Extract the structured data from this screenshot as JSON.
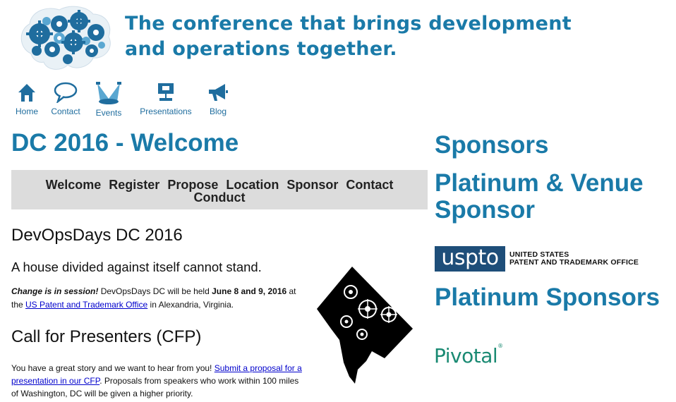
{
  "header": {
    "tagline_line1": "The conference that brings development",
    "tagline_line2": "and operations together."
  },
  "topnav": [
    {
      "label": "Home",
      "icon": "house-icon"
    },
    {
      "label": "Contact",
      "icon": "speech-bubble-icon"
    },
    {
      "label": "Events",
      "icon": "spotlight-icon"
    },
    {
      "label": "Presentations",
      "icon": "projector-icon"
    },
    {
      "label": "Blog",
      "icon": "megaphone-icon"
    }
  ],
  "main": {
    "page_title": "DC 2016 - Welcome",
    "subnav": [
      "Welcome",
      "Register",
      "Propose",
      "Location",
      "Sponsor",
      "Contact",
      "Conduct"
    ],
    "event_heading": "DevOpsDays DC 2016",
    "quote": "A house divided against itself cannot stand.",
    "intro": {
      "em": "Change is in session!",
      "text1": " DevOpsDays DC will be held ",
      "dates": "June 8 and 9, 2016",
      "text2": " at the ",
      "link": "US Patent and Trademark Office",
      "text3": " in Alexandria, Virginia."
    },
    "cfp_heading": "Call for Presenters (CFP)",
    "cfp": {
      "text1": "You have a great story and we want to hear from you! ",
      "link": "Submit a proposal for a presentation in our CFP",
      "text2": ". Proposals from speakers who work within 100 miles of Washington, DC will be given a higher priority."
    }
  },
  "sidebar": {
    "sponsors_heading": "Sponsors",
    "platinum_venue_heading": "Platinum & Venue Sponsor",
    "uspto_logo_box": "uspto",
    "uspto_logo_line1": "UNITED STATES",
    "uspto_logo_line2": "PATENT AND TRADEMARK OFFICE",
    "platinum_sponsors_heading": "Platinum Sponsors",
    "pivotal_logo": "Pivotal",
    "pivotal_mark": "®"
  },
  "colors": {
    "brand_blue": "#1a7aa8",
    "nav_blue": "#1f6d9e",
    "subnav_bg": "#dcdcdc",
    "link": "#0000cc",
    "uspto_navy": "#1e4e79",
    "pivotal_teal": "#1a8a73"
  }
}
